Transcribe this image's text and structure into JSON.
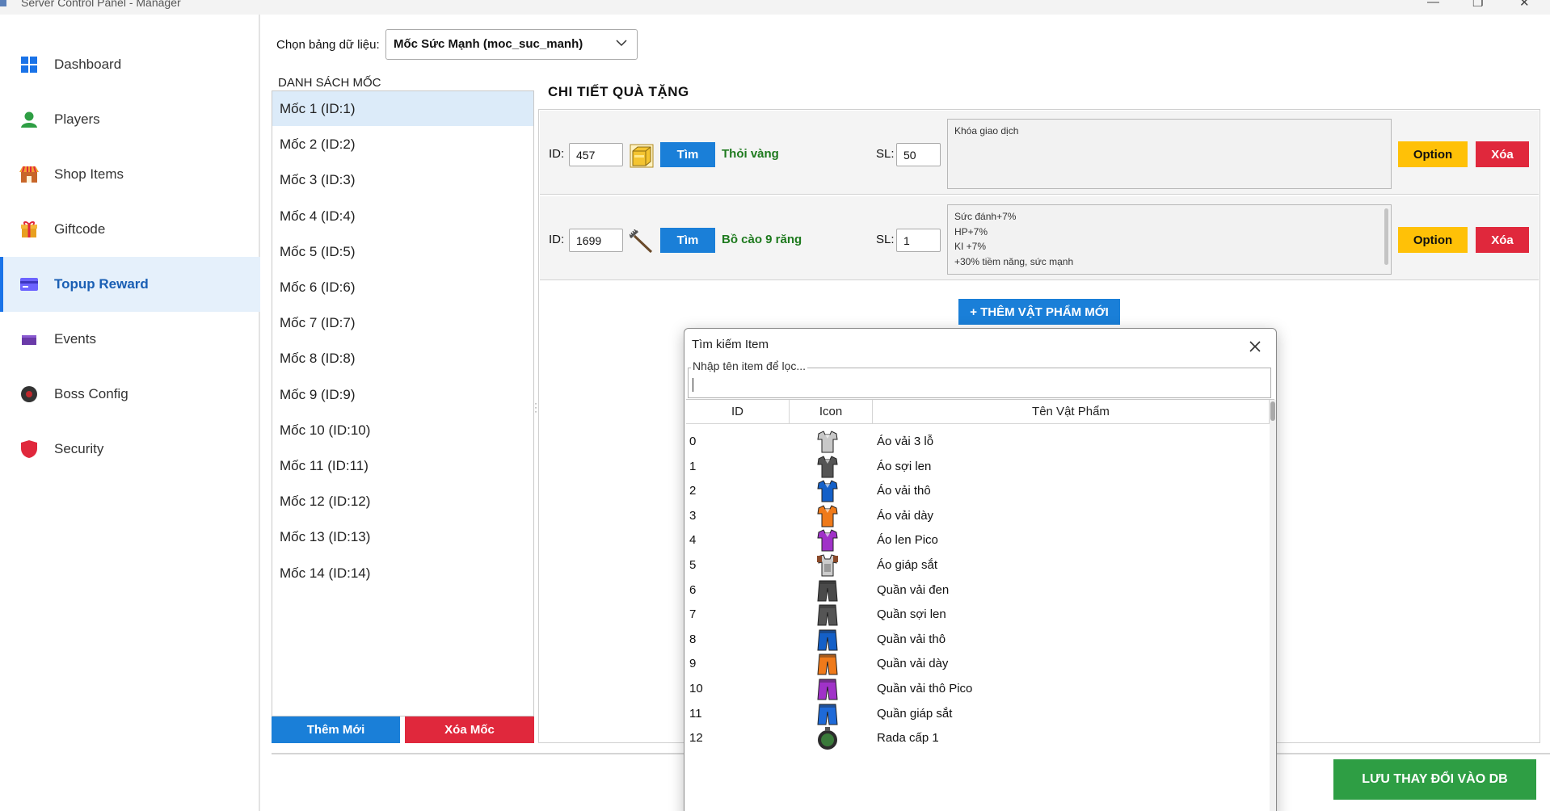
{
  "window": {
    "title": "Server Control Panel - Manager"
  },
  "sidebar": {
    "items": [
      {
        "label": "Dashboard",
        "icon": "dashboard-grid-icon",
        "color": "#1a73e8"
      },
      {
        "label": "Players",
        "icon": "user-icon",
        "color": "#2e9e44"
      },
      {
        "label": "Shop Items",
        "icon": "shop-icon",
        "color": "#f0a030"
      },
      {
        "label": "Giftcode",
        "icon": "gift-icon",
        "color": "#e8a020"
      },
      {
        "label": "Topup Reward",
        "icon": "card-icon",
        "color": "#6c63ff",
        "active": true
      },
      {
        "label": "Events",
        "icon": "flag-icon",
        "color": "#6a3aa8"
      },
      {
        "label": "Boss Config",
        "icon": "boss-icon",
        "color": "#333333"
      },
      {
        "label": "Security",
        "icon": "shield-icon",
        "color": "#e0283c"
      }
    ]
  },
  "table_select": {
    "label": "Chọn bảng dữ liệu:",
    "value": "Mốc Sức Mạnh (moc_suc_manh)"
  },
  "milestones": {
    "title": "DANH SÁCH MỐC",
    "items": [
      "Mốc 1 (ID:1)",
      "Mốc 2 (ID:2)",
      "Mốc 3 (ID:3)",
      "Mốc 4 (ID:4)",
      "Mốc 5 (ID:5)",
      "Mốc 6 (ID:6)",
      "Mốc 7 (ID:7)",
      "Mốc 8 (ID:8)",
      "Mốc 9 (ID:9)",
      "Mốc 10 (ID:10)",
      "Mốc 11 (ID:11)",
      "Mốc 12 (ID:12)",
      "Mốc 13 (ID:13)",
      "Mốc 14 (ID:14)"
    ],
    "selected_index": 0,
    "add_label": "Thêm Mới",
    "delete_label": "Xóa Mốc"
  },
  "detail": {
    "title": "CHI TIẾT QUÀ TẶNG",
    "id_label": "ID:",
    "sl_label": "SL:",
    "find_label": "Tìm",
    "option_label": "Option",
    "delete_label": "Xóa",
    "rewards": [
      {
        "id": "457",
        "name": "Thỏi vàng",
        "qty": "50",
        "icon": "gold-bar-icon",
        "options": [
          "Khóa giao dịch"
        ]
      },
      {
        "id": "1699",
        "name": "Bồ cào 9 răng",
        "qty": "1",
        "icon": "rake-icon",
        "options": [
          "Sức đánh+7%",
          "HP+7%",
          "KI +7%",
          "+30% tiềm năng, sức mạnh"
        ]
      }
    ],
    "add_item_label": "+ THÊM VẬT PHẨM MỚI"
  },
  "save_label": "LƯU THAY ĐỔI VÀO DB",
  "modal": {
    "title": "Tìm kiếm Item",
    "search_placeholder": "Nhập tên item để lọc...",
    "columns": [
      "ID",
      "Icon",
      "Tên Vật Phẩm"
    ],
    "rows": [
      {
        "id": "0",
        "name": "Áo vải 3 lỗ",
        "icon": "shirt-icon",
        "color": "#c8c8c8"
      },
      {
        "id": "1",
        "name": "Áo sợi len",
        "icon": "shirt-icon",
        "color": "#555555"
      },
      {
        "id": "2",
        "name": "Áo vải thô",
        "icon": "shirt-icon",
        "color": "#1460c8"
      },
      {
        "id": "3",
        "name": "Áo vải dày",
        "icon": "shirt-icon",
        "color": "#ef7a1a"
      },
      {
        "id": "4",
        "name": "Áo len Pico",
        "icon": "shirt-icon",
        "color": "#a032c8"
      },
      {
        "id": "5",
        "name": "Áo giáp sắt",
        "icon": "armor-icon",
        "color": "#8a4a2a"
      },
      {
        "id": "6",
        "name": "Quần vải đen",
        "icon": "pants-icon",
        "color": "#4a4a4a"
      },
      {
        "id": "7",
        "name": "Quần sợi len",
        "icon": "pants-icon",
        "color": "#555555"
      },
      {
        "id": "8",
        "name": "Quần vải thô",
        "icon": "pants-icon",
        "color": "#1460c8"
      },
      {
        "id": "9",
        "name": "Quần vải dày",
        "icon": "pants-icon",
        "color": "#ef7a1a"
      },
      {
        "id": "10",
        "name": "Quần vải thô Pico",
        "icon": "pants-icon",
        "color": "#a032c8"
      },
      {
        "id": "11",
        "name": "Quần giáp sắt",
        "icon": "pants-icon",
        "color": "#1e6ad8"
      },
      {
        "id": "12",
        "name": "Rada cấp 1",
        "icon": "radar-icon",
        "color": "#3a7a3a"
      }
    ]
  }
}
